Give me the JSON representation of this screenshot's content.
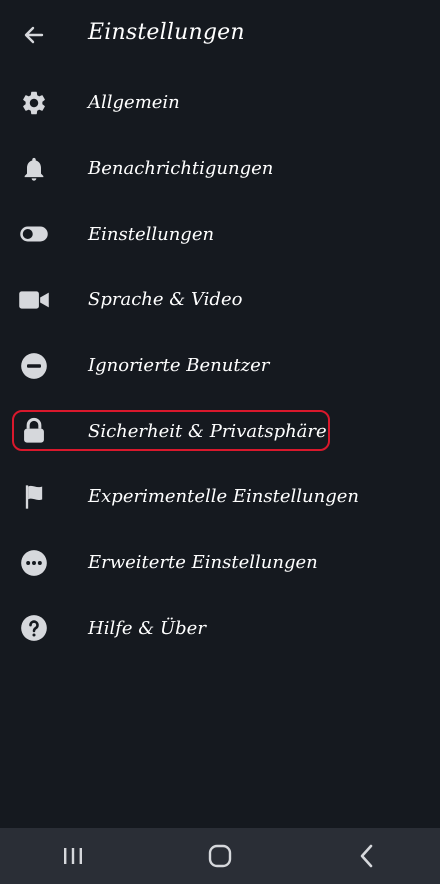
{
  "header": {
    "title": "Einstellungen",
    "back_icon": "arrow-left-icon"
  },
  "menu": {
    "items": [
      {
        "label": "Allgemein",
        "icon": "gear-icon"
      },
      {
        "label": "Benachrichtigungen",
        "icon": "bell-icon"
      },
      {
        "label": "Einstellungen",
        "icon": "toggle-icon"
      },
      {
        "label": "Sprache & Video",
        "icon": "video-camera-icon"
      },
      {
        "label": "Ignorierte Benutzer",
        "icon": "minus-circle-icon"
      },
      {
        "label": "Sicherheit & Privatsphäre",
        "icon": "lock-icon",
        "highlighted": true
      },
      {
        "label": "Experimentelle Einstellungen",
        "icon": "flag-icon"
      },
      {
        "label": "Erweiterte Einstellungen",
        "icon": "more-circle-icon"
      },
      {
        "label": "Hilfe & Über",
        "icon": "help-circle-icon"
      }
    ]
  },
  "highlight_color": "#d9182c",
  "background_color": "#15191f",
  "system_nav": {
    "buttons": [
      "recent-apps-icon",
      "home-icon",
      "back-chevron-icon"
    ]
  }
}
